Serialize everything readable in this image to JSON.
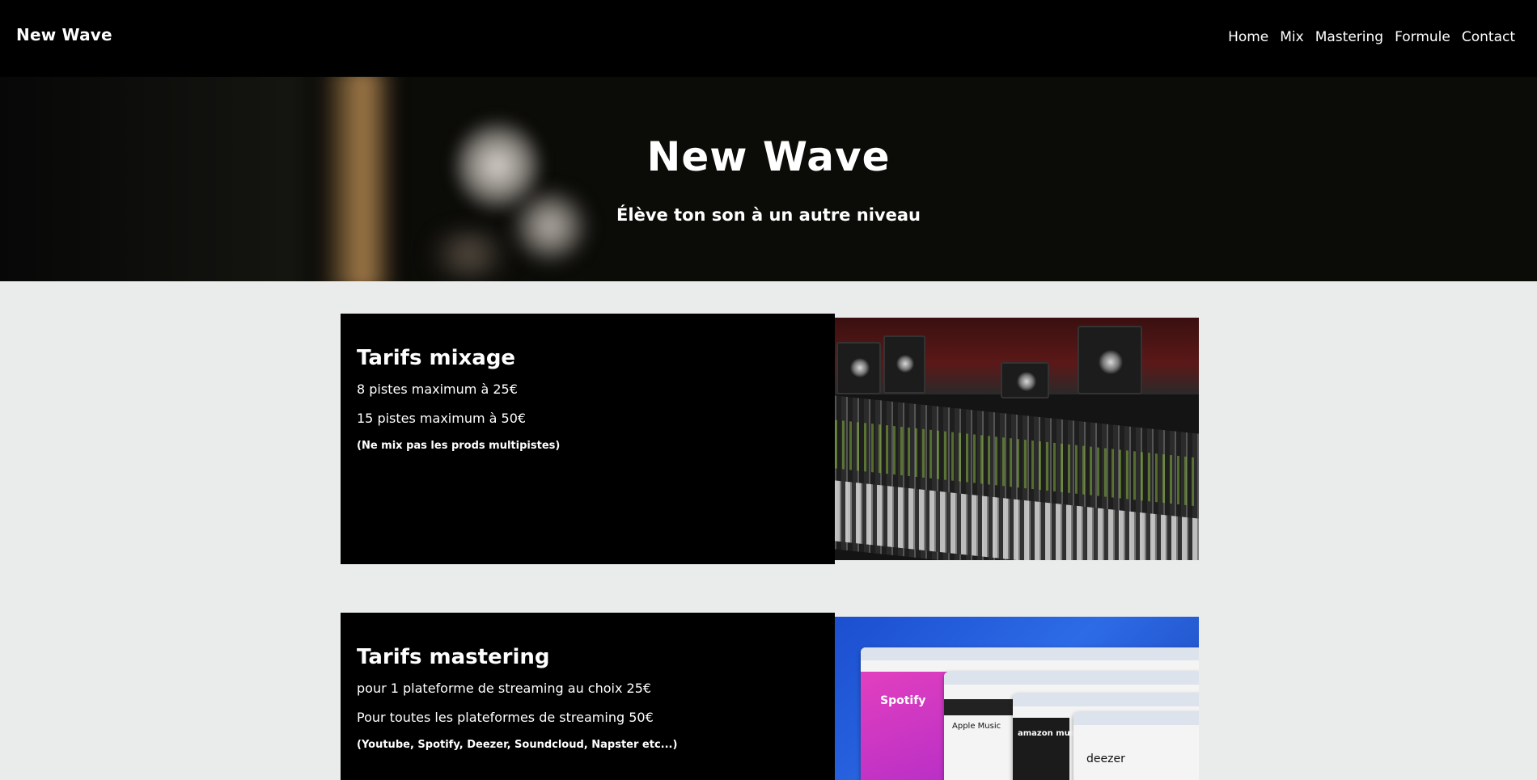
{
  "nav": {
    "brand": "New Wave",
    "items": [
      "Home",
      "Mix",
      "Mastering",
      "Formule",
      "Contact"
    ]
  },
  "hero": {
    "title": "New Wave",
    "subtitle": "Élève ton son à un autre niveau"
  },
  "cards": [
    {
      "title": "Tarifs mixage",
      "lines": [
        "8 pistes maximum à 25€",
        "15 pistes maximum à 50€"
      ],
      "note": "(Ne mix pas les prods multipistes)"
    },
    {
      "title": "Tarifs mastering",
      "lines": [
        "pour 1 plateforme de streaming au choix 25€",
        "Pour toutes les plateformes de streaming 50€"
      ],
      "note": "(Youtube, Spotify, Deezer, Soundcloud, Napster etc...)"
    }
  ],
  "stream_image": {
    "spotify": "Spotify",
    "apple_music": "Apple Music",
    "amazon_music": "amazon music",
    "deezer": "deezer"
  }
}
